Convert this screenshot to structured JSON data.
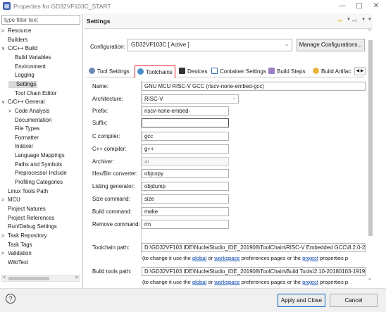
{
  "window": {
    "title": "Properties for GD32VF103C_START",
    "title_icon": "properties-icon",
    "controls": [
      "minimize-icon",
      "maximize-icon",
      "close-icon"
    ]
  },
  "sidebar": {
    "filter_placeholder": "type filter text",
    "items": [
      {
        "label": "Resource",
        "depth": 0,
        "expand": ">"
      },
      {
        "label": "Builders",
        "depth": 0,
        "expand": ""
      },
      {
        "label": "C/C++ Build",
        "depth": 0,
        "expand": "v"
      },
      {
        "label": "Build Variables",
        "depth": 1,
        "expand": ""
      },
      {
        "label": "Environment",
        "depth": 1,
        "expand": ""
      },
      {
        "label": "Logging",
        "depth": 1,
        "expand": ""
      },
      {
        "label": "Settings",
        "depth": 1,
        "expand": "",
        "selected": true
      },
      {
        "label": "Tool Chain Editor",
        "depth": 1,
        "expand": ""
      },
      {
        "label": "C/C++ General",
        "depth": 0,
        "expand": "v"
      },
      {
        "label": "Code Analysis",
        "depth": 1,
        "expand": ">"
      },
      {
        "label": "Documentation",
        "depth": 1,
        "expand": ""
      },
      {
        "label": "File Types",
        "depth": 1,
        "expand": ""
      },
      {
        "label": "Formatter",
        "depth": 1,
        "expand": ""
      },
      {
        "label": "Indexer",
        "depth": 1,
        "expand": ""
      },
      {
        "label": "Language Mappings",
        "depth": 1,
        "expand": ""
      },
      {
        "label": "Paths and Symbols",
        "depth": 1,
        "expand": ""
      },
      {
        "label": "Preprocessor Include",
        "depth": 1,
        "expand": ""
      },
      {
        "label": "Profiling Categories",
        "depth": 1,
        "expand": ""
      },
      {
        "label": "Linux Tools Path",
        "depth": 0,
        "expand": ""
      },
      {
        "label": "MCU",
        "depth": 0,
        "expand": ">"
      },
      {
        "label": "Project Natures",
        "depth": 0,
        "expand": ""
      },
      {
        "label": "Project References",
        "depth": 0,
        "expand": ""
      },
      {
        "label": "Run/Debug Settings",
        "depth": 0,
        "expand": ""
      },
      {
        "label": "Task Repository",
        "depth": 0,
        "expand": ">"
      },
      {
        "label": "Task Tags",
        "depth": 0,
        "expand": ""
      },
      {
        "label": "Validation",
        "depth": 0,
        "expand": ">"
      },
      {
        "label": "WikiText",
        "depth": 0,
        "expand": ""
      }
    ]
  },
  "header": {
    "title": "Settings",
    "nav_icons": [
      "back-arrow-icon",
      "back-dropdown-icon",
      "forward-arrow-icon",
      "forward-dropdown-icon",
      "view-menu-icon"
    ]
  },
  "configuration": {
    "label": "Configuration:",
    "value": "GD32VF103C  [ Active ]",
    "manage_button": "Manage Configurations..."
  },
  "tabs": [
    {
      "label": "Tool Settings",
      "icon": "tool-settings-icon",
      "active": false
    },
    {
      "label": "Toolchains",
      "icon": "toolchains-icon",
      "active": true
    },
    {
      "label": "Devices",
      "icon": "devices-icon",
      "active": false
    },
    {
      "label": "Container Settings",
      "icon": "container-icon",
      "active": false
    },
    {
      "label": "Build Steps",
      "icon": "build-steps-icon",
      "active": false
    },
    {
      "label": "Build Artifac",
      "icon": "build-artifact-icon",
      "active": false
    }
  ],
  "toolchain": {
    "name_label": "Name:",
    "name_value": "GNU MCU RISC-V GCC (riscv-none-embed-gcc)",
    "arch_label": "Architecture:",
    "arch_value": "RISC-V",
    "prefix_label": "Prefix:",
    "prefix_value": "riscv-none-embed-",
    "suffix_label": "Suffix:",
    "suffix_value": "",
    "c_compiler_label": "C compiler:",
    "c_compiler_value": "gcc",
    "cpp_compiler_label": "C++ compiler:",
    "cpp_compiler_value": "g++",
    "archiver_label": "Archiver:",
    "archiver_value": "ar",
    "hexbin_label": "Hex/Bin converter:",
    "hexbin_value": "objcopy",
    "listing_label": "Listing generator:",
    "listing_value": "objdump",
    "size_label": "Size command:",
    "size_value": "size",
    "build_label": "Build command:",
    "build_value": "make",
    "remove_label": "Remove command:",
    "remove_value": "rm",
    "toolchain_path_label": "Toolchain path:",
    "toolchain_path_value": "D:\\GD32VF103 IDE\\NucleiStudio_IDE_201908\\ToolChain\\RISC-V Embedded GCC\\8.2.0-2.2",
    "build_tools_label": "Build tools path:",
    "build_tools_value": "D:\\GD32VF103 IDE\\NucleiStudio_IDE_201908\\ToolChain\\Build Tools\\2.10-20180103-1919",
    "note_prefix": "(to change it use the ",
    "note_global": "global",
    "note_or": " or ",
    "note_workspace": "workspace",
    "note_mid": " preferences pages or the ",
    "note_project": "project",
    "note_suffix": " properties p"
  },
  "footer": {
    "help_icon": "help-icon",
    "apply_close": "Apply and Close",
    "cancel": "Cancel"
  }
}
